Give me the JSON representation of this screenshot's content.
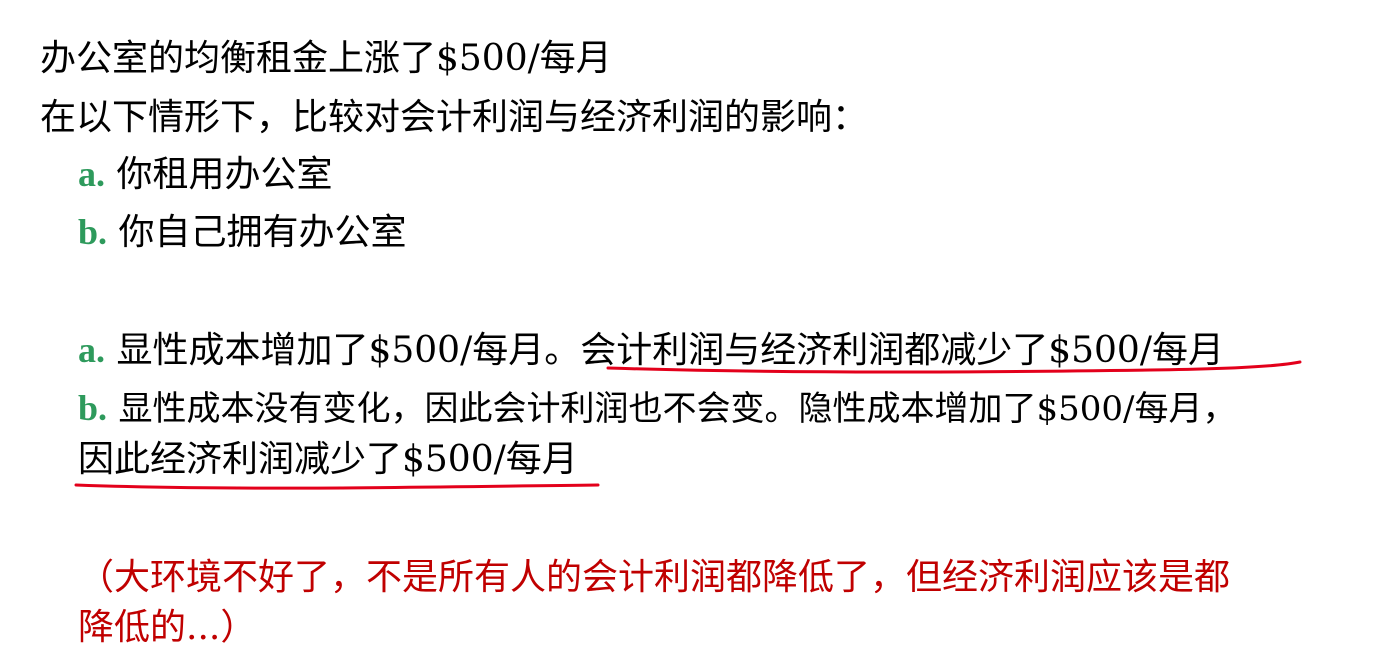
{
  "colors": {
    "text": "#000000",
    "marker": "#2e9a5c",
    "accent_red": "#c00000",
    "underline": "#e3001b"
  },
  "question": {
    "line1": "办公室的均衡租金上涨了$500/每月",
    "line2": "在以下情形下，比较对会计利润与经济利润的影响：",
    "options": [
      {
        "marker": "a.",
        "text": "你租用办公室"
      },
      {
        "marker": "b.",
        "text": "你自己拥有办公室"
      }
    ]
  },
  "answer": {
    "a": {
      "marker": "a.",
      "text": "显性成本增加了$500/每月。",
      "underlined": "会计利润与经济利润都减少了$500/每月"
    },
    "b": {
      "marker": "b.",
      "text": "显性成本没有变化，因此会计利润也不会变。隐性成本增加了$500/每月，",
      "underlined": "因此经济利润减少了$500/每月"
    }
  },
  "note": {
    "line1": "（大环境不好了，不是所有人的会计利润都降低了，但经济利润应该是都",
    "line2": "降低的...）"
  }
}
